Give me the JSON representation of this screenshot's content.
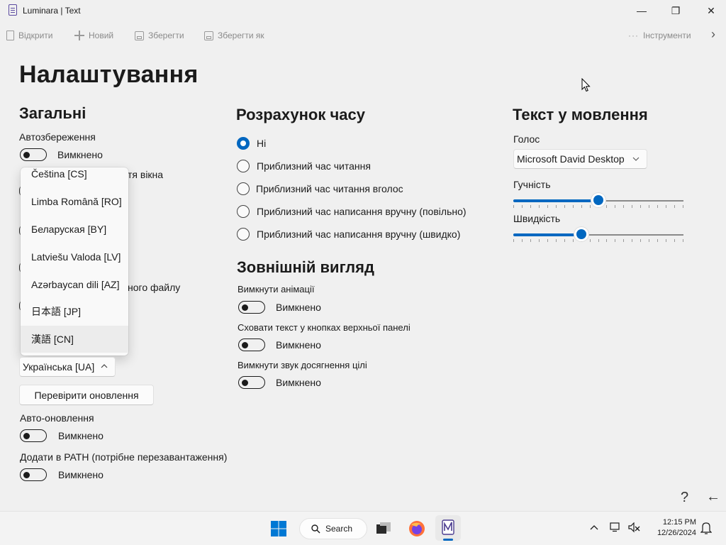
{
  "window": {
    "title": "Luminara | Text",
    "minimize_glyph": "—",
    "maximize_glyph": "❐",
    "close_glyph": "✕"
  },
  "toolbar": {
    "open_label": "Відкрити",
    "new_label": "Новий",
    "save_label": "Зберегти",
    "save_as_label": "Зберегти як",
    "more_glyph": "···",
    "tools_label": "Інструменти",
    "next_glyph": "›"
  },
  "page_title": "Налаштування",
  "general": {
    "heading": "Загальні",
    "autosave_label": "Автозбереження",
    "autosave_state": "Вимкнено",
    "partial_label_1": "тя вікна",
    "partial_label_2": "ного файлу",
    "language_options": [
      "Čeština [CS]",
      "Limba Română [RO]",
      "Беларуская [BY]",
      "Latviešu Valoda [LV]",
      "Azərbaycan dili [AZ]",
      "日本語 [JP]",
      "漢語 [CN]"
    ],
    "language_selected": "Українська [UA]",
    "check_updates_label": "Перевірити оновлення",
    "auto_update_label": "Авто-оновлення",
    "auto_update_state": "Вимкнено",
    "add_path_label": "Додати в PATH (потрібне перезавантаження)",
    "add_path_state": "Вимкнено"
  },
  "time_calc": {
    "heading": "Розрахунок часу",
    "options": [
      "Ні",
      "Приблизний час читання",
      "Приблизний час читання вголос",
      "Приблизний час написання вручну (повільно)",
      "Приблизний час написання вручну (швидко)"
    ],
    "selected_index": 0
  },
  "appearance": {
    "heading": "Зовнішній вигляд",
    "disable_animations_label": "Вимкнути анімації",
    "disable_animations_state": "Вимкнено",
    "hide_toolbar_text_label": "Сховати текст у кнопках верхньої панелі",
    "hide_toolbar_text_state": "Вимкнено",
    "disable_goal_sound_label": "Вимкнути звук досягнення цілі",
    "disable_goal_sound_state": "Вимкнено"
  },
  "tts": {
    "heading": "Текст у мовлення",
    "voice_label": "Голос",
    "voice_selected": "Microsoft David Desktop",
    "volume_label": "Гучність",
    "volume_value": 0.5,
    "speed_label": "Швидкість",
    "speed_value": 0.4
  },
  "footer": {
    "help_glyph": "?",
    "back_glyph": "←"
  },
  "taskbar": {
    "search_label": "Search",
    "time": "12:15 PM",
    "date": "12/26/2024"
  }
}
